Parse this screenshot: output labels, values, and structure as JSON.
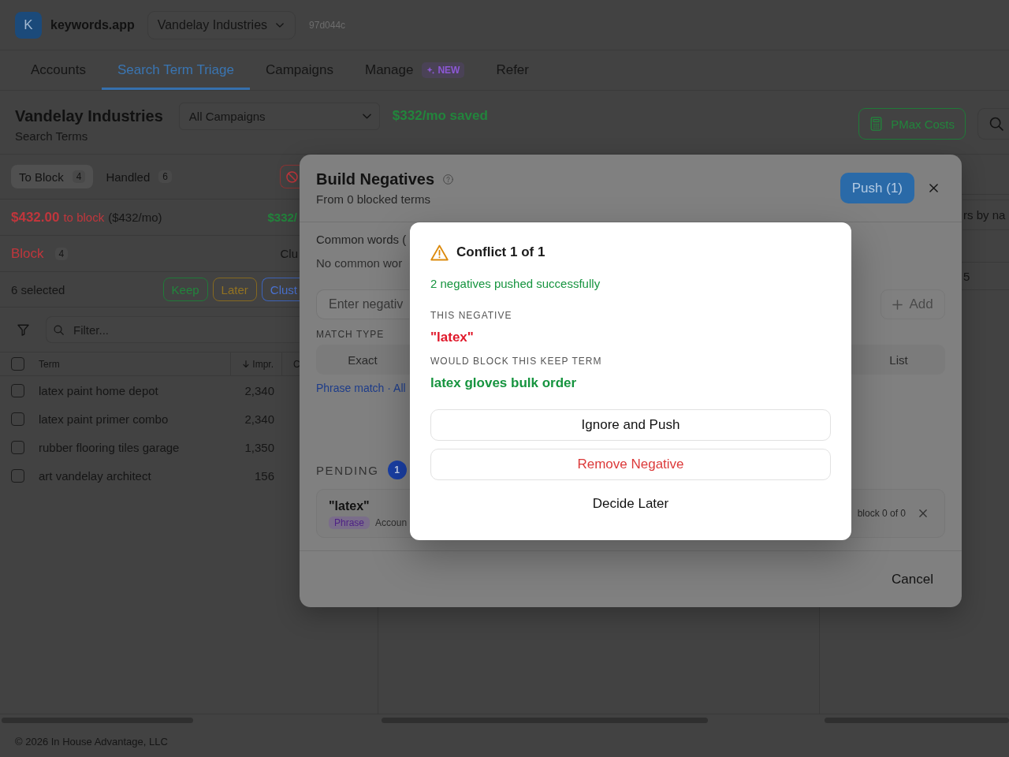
{
  "topbar": {
    "logo": "K",
    "app_name": "keywords.app",
    "account": "Vandelay Industries",
    "build": "97d044c"
  },
  "nav_tabs": [
    {
      "label": "Accounts",
      "selected": false
    },
    {
      "label": "Search Term Triage",
      "selected": true
    },
    {
      "label": "Campaigns",
      "selected": false
    },
    {
      "label": "Manage",
      "selected": false,
      "badge": "NEW"
    },
    {
      "label": "Refer",
      "selected": false
    }
  ],
  "page_header": {
    "title": "Vandelay Industries",
    "subtitle": "Search Terms",
    "campaign_filter": "All Campaigns",
    "savings": "$332/mo saved",
    "pmax_button": "PMax Costs"
  },
  "triage_panel": {
    "tabs": [
      {
        "label": "To Block",
        "count": "4",
        "selected": true
      },
      {
        "label": "Handled",
        "count": "6",
        "selected": false
      }
    ],
    "summary": {
      "amount": "$432.00",
      "label": "to block",
      "monthly": "($432/mo)",
      "saved": "$332/"
    },
    "group": {
      "label": "Block",
      "count": "4",
      "right_label": "Clu"
    },
    "selection": {
      "label": "6 selected",
      "actions": [
        {
          "label": "Keep",
          "kind": "keep"
        },
        {
          "label": "Later",
          "kind": "later"
        },
        {
          "label": "Clust",
          "kind": "cluster"
        }
      ]
    },
    "filter": {
      "placeholder": "Filter..."
    },
    "table": {
      "all_checked": false,
      "columns": [
        {
          "label": "Term",
          "sorted": false
        },
        {
          "label": "Impr.",
          "sorted": true
        },
        {
          "label": "C",
          "sorted": false
        }
      ],
      "rows": [
        {
          "term": "latex paint home depot",
          "impressions": "2,340",
          "checked": false
        },
        {
          "term": "latex paint primer combo",
          "impressions": "2,340",
          "checked": false
        },
        {
          "term": "rubber flooring tiles garage",
          "impressions": "1,350",
          "checked": false
        },
        {
          "term": "art vandelay architect",
          "impressions": "156",
          "checked": false
        }
      ]
    }
  },
  "cluster_panel": {
    "filter": {
      "placeholder": "rs by na"
    },
    "rows": [
      {
        "column_1": "5"
      }
    ]
  },
  "footer": {
    "copyright": "© 2026 In House Advantage, LLC"
  },
  "build_dialog": {
    "title": "Build Negatives",
    "subtitle": "From 0 blocked terms",
    "push_button": "Push (1)",
    "common_words": {
      "heading": "Common words (",
      "empty": "No common wor"
    },
    "input": {
      "placeholder": "Enter negativ"
    },
    "add_button": "Add",
    "match_type": {
      "label": "MATCH TYPE",
      "options": [
        {
          "label": "Exact",
          "selected": false
        },
        {
          "label": "List",
          "selected": false
        }
      ]
    },
    "match_summary": "Phrase match · All",
    "pending": {
      "label": "PENDING",
      "count": "1",
      "items": [
        {
          "term": "\"latex\"",
          "match": "Phrase",
          "scope": "Accoun",
          "status": "block 0 of 0"
        }
      ]
    },
    "cancel_button": "Cancel"
  },
  "conflict_dialog": {
    "title": "Conflict 1 of 1",
    "success_message": "2 negatives pushed successfully",
    "negative_label": "THIS NEGATIVE",
    "negative": "\"latex\"",
    "keep_label": "WOULD BLOCK THIS KEEP TERM",
    "keep_term": "latex gloves bulk order",
    "actions": [
      {
        "label": "Ignore and Push",
        "kind": "outline"
      },
      {
        "label": "Remove Negative",
        "kind": "danger"
      },
      {
        "label": "Decide Later",
        "kind": "plain"
      }
    ]
  }
}
